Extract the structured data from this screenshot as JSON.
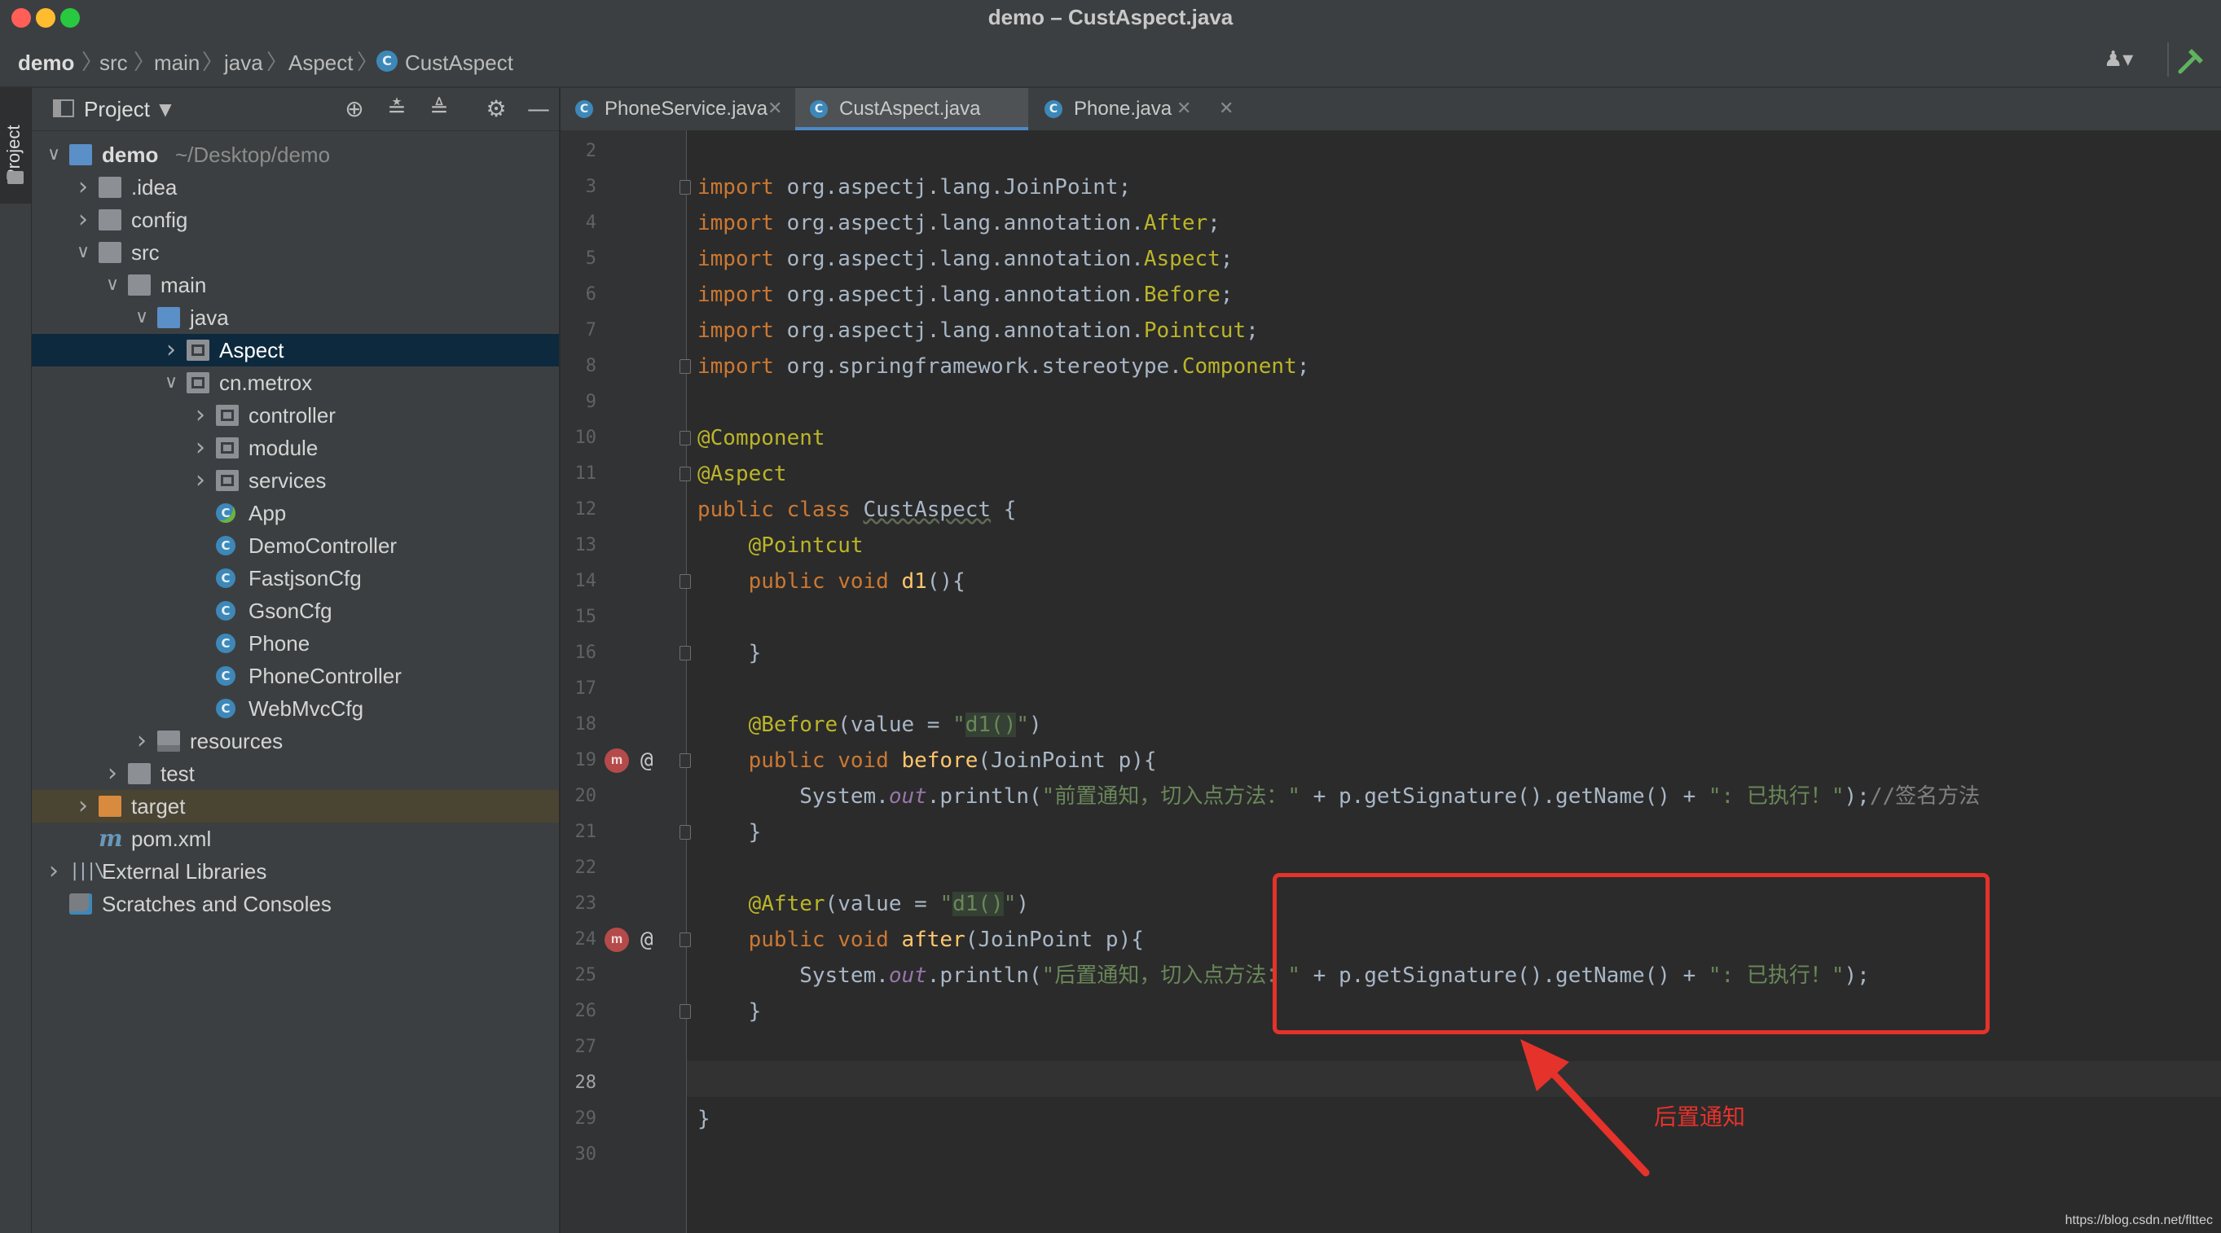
{
  "window": {
    "title": "demo – CustAspect.java",
    "colors": {
      "close": "#ff5f57",
      "minimize": "#febc2e",
      "zoom": "#28c840"
    }
  },
  "breadcrumb": [
    "demo",
    "src",
    "main",
    "java",
    "Aspect",
    "CustAspect"
  ],
  "toolstrip": {
    "label": "Project"
  },
  "project_panel": {
    "title": "Project",
    "tree": [
      {
        "label": "demo",
        "suffix": "~/Desktop/demo",
        "icon": "module-folder-icon",
        "arrow": "down"
      },
      {
        "label": ".idea",
        "icon": "folder-icon",
        "arrow": "right"
      },
      {
        "label": "config",
        "icon": "folder-icon",
        "arrow": "right"
      },
      {
        "label": "src",
        "icon": "folder-icon",
        "arrow": "down"
      },
      {
        "label": "main",
        "icon": "folder-icon",
        "arrow": "down"
      },
      {
        "label": "java",
        "icon": "source-folder-icon",
        "arrow": "down"
      },
      {
        "label": "Aspect",
        "icon": "package-icon",
        "arrow": "right",
        "selected": true
      },
      {
        "label": "cn.metrox",
        "icon": "package-icon",
        "arrow": "down"
      },
      {
        "label": "controller",
        "icon": "package-icon",
        "arrow": "right"
      },
      {
        "label": "module",
        "icon": "package-icon",
        "arrow": "right"
      },
      {
        "label": "services",
        "icon": "package-icon",
        "arrow": "right"
      },
      {
        "label": "App",
        "icon": "spring-class-icon",
        "arrow": ""
      },
      {
        "label": "DemoController",
        "icon": "class-icon",
        "arrow": ""
      },
      {
        "label": "FastjsonCfg",
        "icon": "class-icon",
        "arrow": ""
      },
      {
        "label": "GsonCfg",
        "icon": "class-icon",
        "arrow": ""
      },
      {
        "label": "Phone",
        "icon": "class-icon",
        "arrow": ""
      },
      {
        "label": "PhoneController",
        "icon": "class-icon",
        "arrow": ""
      },
      {
        "label": "WebMvcCfg",
        "icon": "class-icon",
        "arrow": ""
      },
      {
        "label": "resources",
        "icon": "resources-folder-icon",
        "arrow": "right"
      },
      {
        "label": "test",
        "icon": "folder-icon",
        "arrow": "right"
      },
      {
        "label": "target",
        "icon": "excluded-folder-icon",
        "arrow": "right",
        "dimmed": true
      },
      {
        "label": "pom.xml",
        "icon": "maven-icon",
        "arrow": ""
      },
      {
        "label": "External Libraries",
        "icon": "libraries-icon",
        "arrow": "right"
      },
      {
        "label": "Scratches and Consoles",
        "icon": "scratches-icon",
        "arrow": ""
      }
    ]
  },
  "tabs": [
    {
      "label": "PhoneService.java",
      "active": false
    },
    {
      "label": "CustAspect.java",
      "active": true
    },
    {
      "label": "Phone.java",
      "active": false
    }
  ],
  "editor": {
    "current_line": 28,
    "lines": [
      {
        "n": 2,
        "tokens": []
      },
      {
        "n": 3,
        "tokens": [
          [
            "kw",
            "import "
          ],
          [
            "p",
            "org.aspectj.lang.JoinPoint;"
          ]
        ]
      },
      {
        "n": 4,
        "tokens": [
          [
            "kw",
            "import "
          ],
          [
            "p",
            "org.aspectj.lang.annotation."
          ],
          [
            "ann",
            "After"
          ],
          [
            "p",
            ";"
          ]
        ]
      },
      {
        "n": 5,
        "tokens": [
          [
            "kw",
            "import "
          ],
          [
            "p",
            "org.aspectj.lang.annotation."
          ],
          [
            "ann",
            "Aspect"
          ],
          [
            "p",
            ";"
          ]
        ]
      },
      {
        "n": 6,
        "tokens": [
          [
            "kw",
            "import "
          ],
          [
            "p",
            "org.aspectj.lang.annotation."
          ],
          [
            "ann",
            "Before"
          ],
          [
            "p",
            ";"
          ]
        ]
      },
      {
        "n": 7,
        "tokens": [
          [
            "kw",
            "import "
          ],
          [
            "p",
            "org.aspectj.lang.annotation."
          ],
          [
            "ann",
            "Pointcut"
          ],
          [
            "p",
            ";"
          ]
        ]
      },
      {
        "n": 8,
        "tokens": [
          [
            "kw",
            "import "
          ],
          [
            "p",
            "org.springframework.stereotype."
          ],
          [
            "ann",
            "Component"
          ],
          [
            "p",
            ";"
          ]
        ]
      },
      {
        "n": 9,
        "tokens": []
      },
      {
        "n": 10,
        "tokens": [
          [
            "ann",
            "@Component"
          ]
        ]
      },
      {
        "n": 11,
        "tokens": [
          [
            "ann",
            "@Aspect"
          ]
        ]
      },
      {
        "n": 12,
        "tokens": [
          [
            "kw",
            "public class "
          ],
          [
            "p",
            "CustAspect {"
          ]
        ]
      },
      {
        "n": 13,
        "tokens": [
          [
            "p",
            "    "
          ],
          [
            "ann",
            "@Pointcut"
          ]
        ]
      },
      {
        "n": 14,
        "tokens": [
          [
            "p",
            "    "
          ],
          [
            "kw",
            "public void "
          ],
          [
            "fn",
            "d1"
          ],
          [
            "p",
            "(){"
          ]
        ]
      },
      {
        "n": 15,
        "tokens": []
      },
      {
        "n": 16,
        "tokens": [
          [
            "p",
            "    }"
          ]
        ]
      },
      {
        "n": 17,
        "tokens": []
      },
      {
        "n": 18,
        "tokens": [
          [
            "p",
            "    "
          ],
          [
            "ann",
            "@Before"
          ],
          [
            "p",
            "(value = "
          ],
          [
            "str",
            "\""
          ],
          [
            "strhl",
            "d1()"
          ],
          [
            "str",
            "\""
          ],
          [
            "p",
            ")"
          ]
        ]
      },
      {
        "n": 19,
        "tokens": [
          [
            "p",
            "    "
          ],
          [
            "kw",
            "public void "
          ],
          [
            "fn",
            "before"
          ],
          [
            "p",
            "(JoinPoint p){"
          ]
        ]
      },
      {
        "n": 20,
        "tokens": [
          [
            "p",
            "        System."
          ],
          [
            "st",
            "out"
          ],
          [
            "p",
            ".println("
          ],
          [
            "str",
            "\"前置通知，切入点方法：\""
          ],
          [
            "p",
            " + p.getSignature().getName() + "
          ],
          [
            "str",
            "\": 已执行！\""
          ],
          [
            "p",
            ");"
          ],
          [
            "cmt",
            "//签名方法"
          ]
        ]
      },
      {
        "n": 21,
        "tokens": [
          [
            "p",
            "    }"
          ]
        ]
      },
      {
        "n": 22,
        "tokens": []
      },
      {
        "n": 23,
        "tokens": [
          [
            "p",
            "    "
          ],
          [
            "ann",
            "@After"
          ],
          [
            "p",
            "(value = "
          ],
          [
            "str",
            "\""
          ],
          [
            "strhl",
            "d1()"
          ],
          [
            "str",
            "\""
          ],
          [
            "p",
            ")"
          ]
        ]
      },
      {
        "n": 24,
        "tokens": [
          [
            "p",
            "    "
          ],
          [
            "kw",
            "public void "
          ],
          [
            "fn",
            "after"
          ],
          [
            "p",
            "(JoinPoint p){"
          ]
        ]
      },
      {
        "n": 25,
        "tokens": [
          [
            "p",
            "        System."
          ],
          [
            "st",
            "out"
          ],
          [
            "p",
            ".println("
          ],
          [
            "str",
            "\"后置通知，切入点方法：\""
          ],
          [
            "p",
            " + p.getSignature().getName() + "
          ],
          [
            "str",
            "\": 已执行！\""
          ],
          [
            "p",
            ");"
          ]
        ]
      },
      {
        "n": 26,
        "tokens": [
          [
            "p",
            "    }"
          ]
        ]
      },
      {
        "n": 27,
        "tokens": []
      },
      {
        "n": 28,
        "tokens": []
      },
      {
        "n": 29,
        "tokens": [
          [
            "p",
            "}"
          ]
        ]
      },
      {
        "n": 30,
        "tokens": []
      }
    ],
    "gutter_icons": [
      19,
      24
    ],
    "annotation": {
      "label": "后置通知",
      "color": "#e5322b"
    }
  },
  "watermark": "https://blog.csdn.net/flttec"
}
